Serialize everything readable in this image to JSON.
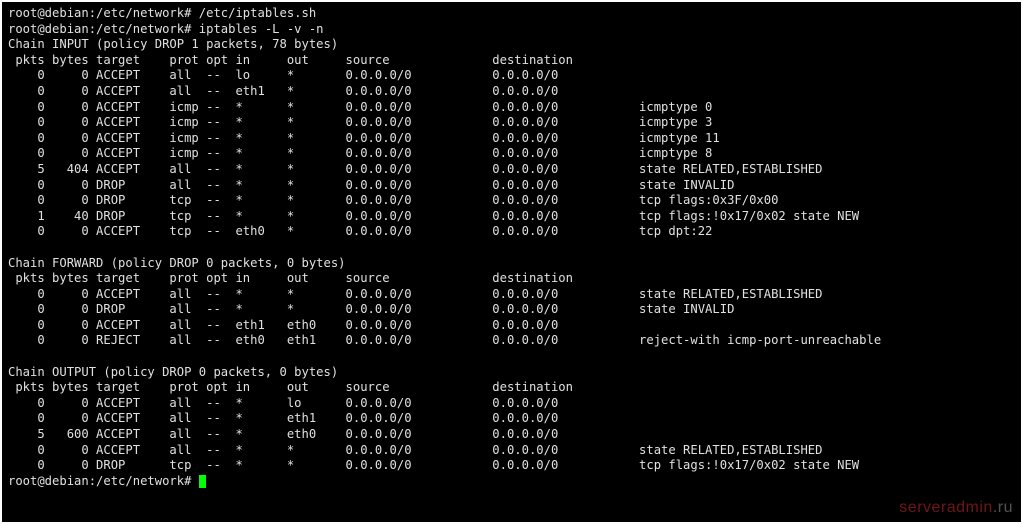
{
  "prompts": [
    {
      "user": "root",
      "host": "debian",
      "cwd": "/etc/network",
      "sep": "#",
      "cmd": "/etc/iptables.sh"
    },
    {
      "user": "root",
      "host": "debian",
      "cwd": "/etc/network",
      "sep": "#",
      "cmd": "iptables -L -v -n"
    }
  ],
  "chains": [
    {
      "name": "INPUT",
      "policy": "DROP",
      "policy_pkts": "1",
      "policy_bytes": "78",
      "header": {
        "pkts": "pkts",
        "bytes": "bytes",
        "target": "target",
        "prot": "prot",
        "opt": "opt",
        "in": "in",
        "out": "out",
        "source": "source",
        "destination": "destination"
      },
      "rules": [
        {
          "pkts": "0",
          "bytes": "0",
          "target": "ACCEPT",
          "prot": "all",
          "opt": "--",
          "in": "lo",
          "out": "*",
          "source": "0.0.0.0/0",
          "destination": "0.0.0.0/0",
          "extra": ""
        },
        {
          "pkts": "0",
          "bytes": "0",
          "target": "ACCEPT",
          "prot": "all",
          "opt": "--",
          "in": "eth1",
          "out": "*",
          "source": "0.0.0.0/0",
          "destination": "0.0.0.0/0",
          "extra": ""
        },
        {
          "pkts": "0",
          "bytes": "0",
          "target": "ACCEPT",
          "prot": "icmp",
          "opt": "--",
          "in": "*",
          "out": "*",
          "source": "0.0.0.0/0",
          "destination": "0.0.0.0/0",
          "extra": "icmptype 0"
        },
        {
          "pkts": "0",
          "bytes": "0",
          "target": "ACCEPT",
          "prot": "icmp",
          "opt": "--",
          "in": "*",
          "out": "*",
          "source": "0.0.0.0/0",
          "destination": "0.0.0.0/0",
          "extra": "icmptype 3"
        },
        {
          "pkts": "0",
          "bytes": "0",
          "target": "ACCEPT",
          "prot": "icmp",
          "opt": "--",
          "in": "*",
          "out": "*",
          "source": "0.0.0.0/0",
          "destination": "0.0.0.0/0",
          "extra": "icmptype 11"
        },
        {
          "pkts": "0",
          "bytes": "0",
          "target": "ACCEPT",
          "prot": "icmp",
          "opt": "--",
          "in": "*",
          "out": "*",
          "source": "0.0.0.0/0",
          "destination": "0.0.0.0/0",
          "extra": "icmptype 8"
        },
        {
          "pkts": "5",
          "bytes": "404",
          "target": "ACCEPT",
          "prot": "all",
          "opt": "--",
          "in": "*",
          "out": "*",
          "source": "0.0.0.0/0",
          "destination": "0.0.0.0/0",
          "extra": "state RELATED,ESTABLISHED"
        },
        {
          "pkts": "0",
          "bytes": "0",
          "target": "DROP",
          "prot": "all",
          "opt": "--",
          "in": "*",
          "out": "*",
          "source": "0.0.0.0/0",
          "destination": "0.0.0.0/0",
          "extra": "state INVALID"
        },
        {
          "pkts": "0",
          "bytes": "0",
          "target": "DROP",
          "prot": "tcp",
          "opt": "--",
          "in": "*",
          "out": "*",
          "source": "0.0.0.0/0",
          "destination": "0.0.0.0/0",
          "extra": "tcp flags:0x3F/0x00"
        },
        {
          "pkts": "1",
          "bytes": "40",
          "target": "DROP",
          "prot": "tcp",
          "opt": "--",
          "in": "*",
          "out": "*",
          "source": "0.0.0.0/0",
          "destination": "0.0.0.0/0",
          "extra": "tcp flags:!0x17/0x02 state NEW"
        },
        {
          "pkts": "0",
          "bytes": "0",
          "target": "ACCEPT",
          "prot": "tcp",
          "opt": "--",
          "in": "eth0",
          "out": "*",
          "source": "0.0.0.0/0",
          "destination": "0.0.0.0/0",
          "extra": "tcp dpt:22"
        }
      ]
    },
    {
      "name": "FORWARD",
      "policy": "DROP",
      "policy_pkts": "0",
      "policy_bytes": "0",
      "header": {
        "pkts": "pkts",
        "bytes": "bytes",
        "target": "target",
        "prot": "prot",
        "opt": "opt",
        "in": "in",
        "out": "out",
        "source": "source",
        "destination": "destination"
      },
      "rules": [
        {
          "pkts": "0",
          "bytes": "0",
          "target": "ACCEPT",
          "prot": "all",
          "opt": "--",
          "in": "*",
          "out": "*",
          "source": "0.0.0.0/0",
          "destination": "0.0.0.0/0",
          "extra": "state RELATED,ESTABLISHED"
        },
        {
          "pkts": "0",
          "bytes": "0",
          "target": "DROP",
          "prot": "all",
          "opt": "--",
          "in": "*",
          "out": "*",
          "source": "0.0.0.0/0",
          "destination": "0.0.0.0/0",
          "extra": "state INVALID"
        },
        {
          "pkts": "0",
          "bytes": "0",
          "target": "ACCEPT",
          "prot": "all",
          "opt": "--",
          "in": "eth1",
          "out": "eth0",
          "source": "0.0.0.0/0",
          "destination": "0.0.0.0/0",
          "extra": ""
        },
        {
          "pkts": "0",
          "bytes": "0",
          "target": "REJECT",
          "prot": "all",
          "opt": "--",
          "in": "eth0",
          "out": "eth1",
          "source": "0.0.0.0/0",
          "destination": "0.0.0.0/0",
          "extra": "reject-with icmp-port-unreachable"
        }
      ]
    },
    {
      "name": "OUTPUT",
      "policy": "DROP",
      "policy_pkts": "0",
      "policy_bytes": "0",
      "header": {
        "pkts": "pkts",
        "bytes": "bytes",
        "target": "target",
        "prot": "prot",
        "opt": "opt",
        "in": "in",
        "out": "out",
        "source": "source",
        "destination": "destination"
      },
      "rules": [
        {
          "pkts": "0",
          "bytes": "0",
          "target": "ACCEPT",
          "prot": "all",
          "opt": "--",
          "in": "*",
          "out": "lo",
          "source": "0.0.0.0/0",
          "destination": "0.0.0.0/0",
          "extra": ""
        },
        {
          "pkts": "0",
          "bytes": "0",
          "target": "ACCEPT",
          "prot": "all",
          "opt": "--",
          "in": "*",
          "out": "eth1",
          "source": "0.0.0.0/0",
          "destination": "0.0.0.0/0",
          "extra": ""
        },
        {
          "pkts": "5",
          "bytes": "600",
          "target": "ACCEPT",
          "prot": "all",
          "opt": "--",
          "in": "*",
          "out": "eth0",
          "source": "0.0.0.0/0",
          "destination": "0.0.0.0/0",
          "extra": ""
        },
        {
          "pkts": "0",
          "bytes": "0",
          "target": "ACCEPT",
          "prot": "all",
          "opt": "--",
          "in": "*",
          "out": "*",
          "source": "0.0.0.0/0",
          "destination": "0.0.0.0/0",
          "extra": "state RELATED,ESTABLISHED"
        },
        {
          "pkts": "0",
          "bytes": "0",
          "target": "DROP",
          "prot": "tcp",
          "opt": "--",
          "in": "*",
          "out": "*",
          "source": "0.0.0.0/0",
          "destination": "0.0.0.0/0",
          "extra": "tcp flags:!0x17/0x02 state NEW"
        }
      ]
    }
  ],
  "final_prompt": {
    "user": "root",
    "host": "debian",
    "cwd": "/etc/network",
    "sep": "#"
  },
  "watermark": {
    "main": "serveradmin",
    "suffix": ".ru"
  }
}
